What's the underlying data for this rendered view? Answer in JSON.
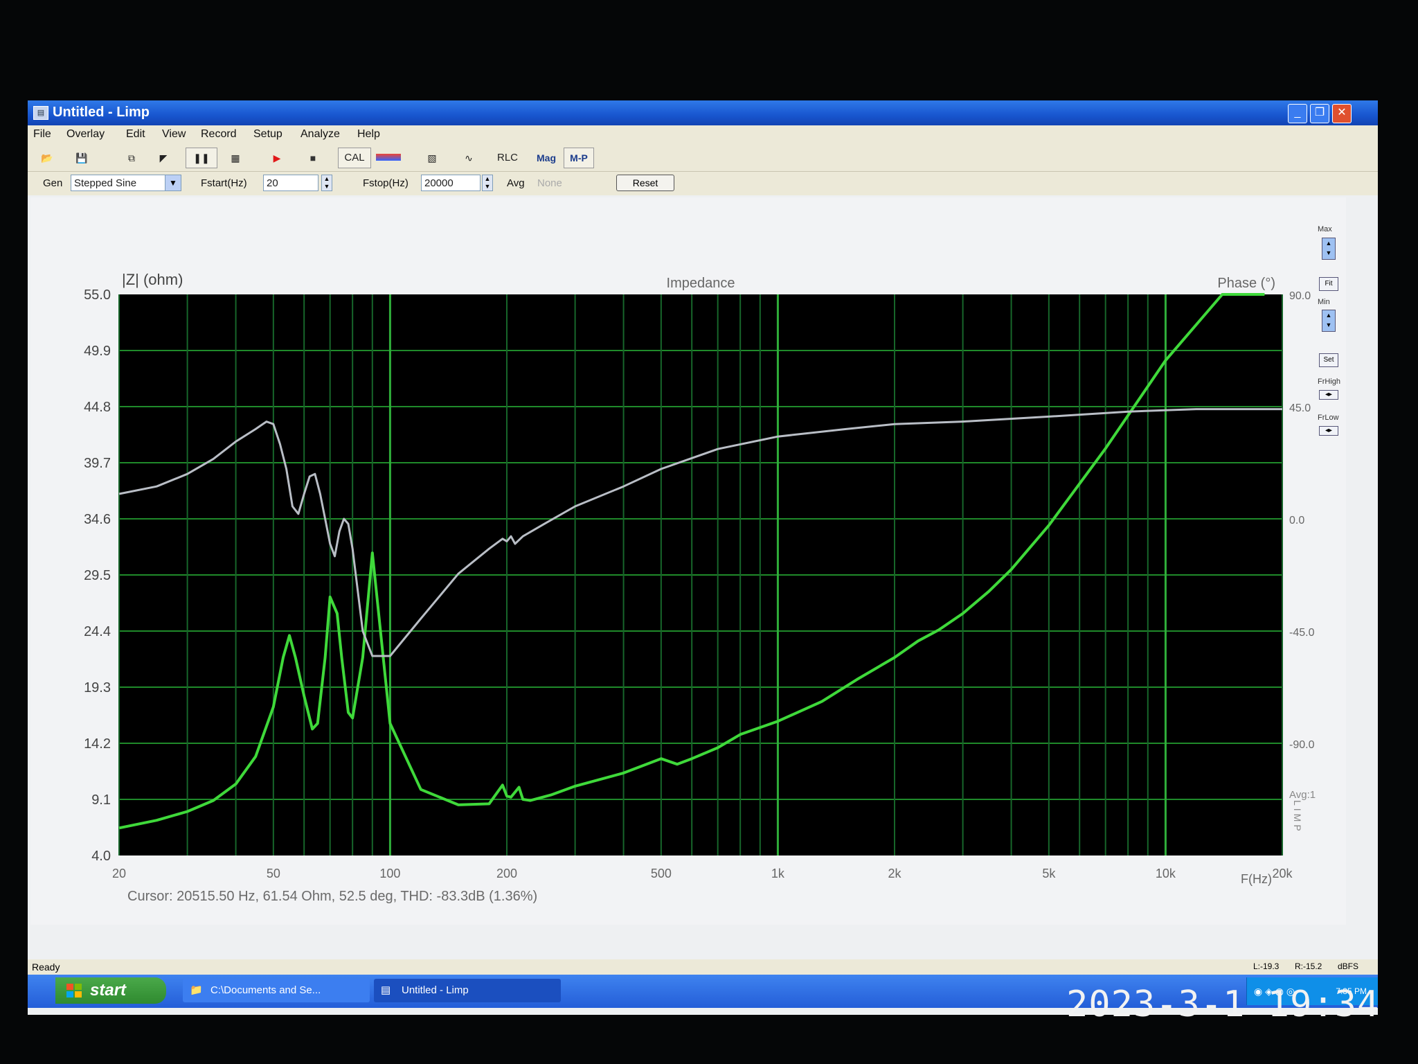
{
  "window": {
    "title": "Untitled - Limp",
    "icon": "limp-app-icon",
    "controls": {
      "minimize": "_",
      "maximize": "❐",
      "close": "✕"
    }
  },
  "menu": [
    "File",
    "Overlay",
    "Edit",
    "View",
    "Record",
    "Setup",
    "Analyze",
    "Help"
  ],
  "toolbar": {
    "cal_label": "CAL",
    "rlc_label": "RLC",
    "mag_label": "Mag",
    "mp_label": "M-P"
  },
  "gen": {
    "label": "Gen",
    "value": "Stepped Sine",
    "fstart_label": "Fstart(Hz)",
    "fstart_value": "20",
    "fstop_label": "Fstop(Hz)",
    "fstop_value": "20000",
    "avg_label": "Avg",
    "avg_value": "None",
    "reset_label": "Reset"
  },
  "side": {
    "max_label": "Max",
    "fit_label": "Fit",
    "min_label": "Min",
    "set_label": "Set",
    "frhigh_label": "FrHigh",
    "frlow_label": "FrLow"
  },
  "chart_data": {
    "type": "line",
    "title": "Impedance",
    "ylabel": "|Z| (ohm)",
    "ylabel_right": "Phase (°)",
    "xlabel": "F(Hz)",
    "xscale": "log",
    "xlim": [
      20,
      20000
    ],
    "ylim": [
      4.0,
      55.0
    ],
    "ylim_right": [
      -135,
      90
    ],
    "yticks": [
      "55.0",
      "49.9",
      "44.8",
      "39.7",
      "34.6",
      "29.5",
      "24.4",
      "19.3",
      "14.2",
      "9.1",
      "4.0"
    ],
    "yticks_right": [
      "90.0",
      "45.0",
      "0.0",
      "-45.0",
      "-90.0"
    ],
    "xticks": [
      {
        "v": 20,
        "label": "20"
      },
      {
        "v": 50,
        "label": "50"
      },
      {
        "v": 100,
        "label": "100"
      },
      {
        "v": 200,
        "label": "200"
      },
      {
        "v": 500,
        "label": "500"
      },
      {
        "v": 1000,
        "label": "1k"
      },
      {
        "v": 2000,
        "label": "2k"
      },
      {
        "v": 5000,
        "label": "5k"
      },
      {
        "v": 10000,
        "label": "10k"
      },
      {
        "v": 20000,
        "label": "20k"
      }
    ],
    "grid": true,
    "avg_note": "Avg:1",
    "vertical_tag": "LIMP",
    "series": [
      {
        "role": "impedance",
        "color": "#3fd93a",
        "x": [
          20,
          25,
          30,
          35,
          40,
          45,
          50,
          53,
          55,
          57,
          60,
          63,
          65,
          68,
          70,
          73,
          75,
          78,
          80,
          85,
          90,
          100,
          120,
          150,
          180,
          195,
          200,
          205,
          215,
          220,
          230,
          260,
          300,
          400,
          500,
          550,
          600,
          700,
          800,
          1000,
          1300,
          1600,
          2000,
          2300,
          2600,
          3000,
          3500,
          4000,
          5000,
          7000,
          10000,
          14000,
          18000
        ],
        "y": [
          6.5,
          7.2,
          8.0,
          9.0,
          10.5,
          13.0,
          17.5,
          22.0,
          24.0,
          22.0,
          18.5,
          15.5,
          16.0,
          22.0,
          27.5,
          26.0,
          22.0,
          17.0,
          16.5,
          22.0,
          31.5,
          16.0,
          10.0,
          8.6,
          8.7,
          10.4,
          9.4,
          9.3,
          10.2,
          9.1,
          9.0,
          9.5,
          10.3,
          11.5,
          12.8,
          12.3,
          12.8,
          13.8,
          15.0,
          16.2,
          18.0,
          20.0,
          22.0,
          23.5,
          24.5,
          26.0,
          28.0,
          30.0,
          34.0,
          41.0,
          49.0,
          57.0,
          60.0
        ]
      },
      {
        "role": "phase",
        "color": "#b9bec6",
        "x": [
          20,
          25,
          30,
          35,
          40,
          45,
          48,
          50,
          52,
          54,
          56,
          58,
          60,
          62,
          64,
          66,
          68,
          70,
          72,
          74,
          76,
          78,
          80,
          85,
          90,
          100,
          120,
          150,
          180,
          195,
          200,
          205,
          210,
          220,
          250,
          300,
          400,
          500,
          700,
          1000,
          1500,
          2000,
          3000,
          5000,
          8000,
          12000,
          20000
        ],
        "y": [
          10,
          13,
          18,
          24,
          31,
          36,
          39,
          38,
          30,
          20,
          5,
          2,
          10,
          17,
          18,
          10,
          0,
          -10,
          -15,
          -5,
          0,
          -2,
          -12,
          -45,
          -55,
          -55,
          -40,
          -22,
          -12,
          -8,
          -9,
          -7,
          -10,
          -7,
          -2,
          5,
          13,
          20,
          28,
          33,
          36,
          38,
          39,
          41,
          43,
          44,
          44
        ]
      }
    ]
  },
  "cursor_readout": "Cursor: 20515.50 Hz, 61.54 Ohm, 52.5 deg, THD: -83.3dB (1.36%)",
  "status": {
    "left": "Ready",
    "l_value": "L:-19.3",
    "r_value": "R:-15.2",
    "unit": "dBFS"
  },
  "taskbar": {
    "start_label": "start",
    "tasks": [
      "C:\\Documents and Se...",
      "Untitled - Limp"
    ],
    "clock": "7:35 PM"
  },
  "photo_timestamp": "2023-3-1 19:34"
}
